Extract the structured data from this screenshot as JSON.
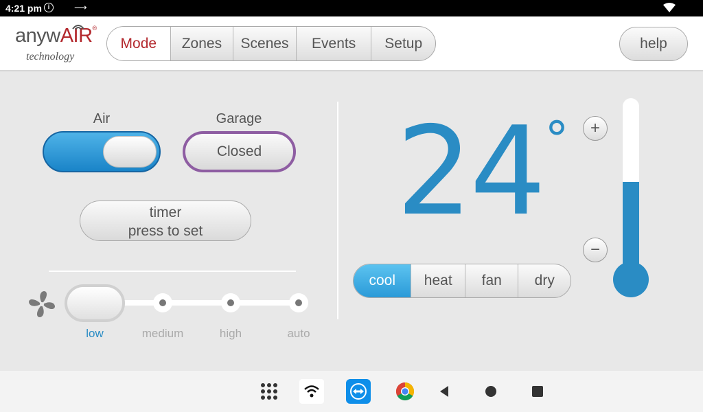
{
  "status_bar": {
    "time": "4:21 pm",
    "info_icon": "info-icon",
    "cast_icon": "cast-icon",
    "wifi_icon": "wifi-icon"
  },
  "logo": {
    "prefix": "anyw",
    "brand": "AIR",
    "reg": "®",
    "sub": "technology"
  },
  "tabs": [
    {
      "label": "Mode",
      "active": true
    },
    {
      "label": "Zones",
      "active": false
    },
    {
      "label": "Scenes",
      "active": false
    },
    {
      "label": "Events",
      "active": false
    },
    {
      "label": "Setup",
      "active": false
    }
  ],
  "help_label": "help",
  "air": {
    "label": "Air",
    "on": true
  },
  "garage": {
    "label": "Garage",
    "state": "Closed"
  },
  "timer": {
    "line1": "timer",
    "line2": "press to set"
  },
  "fan": {
    "speeds": [
      "low",
      "medium",
      "high",
      "auto"
    ],
    "selected": "low"
  },
  "temperature": {
    "value": "24",
    "unit": "°"
  },
  "modes": [
    {
      "label": "cool",
      "active": true
    },
    {
      "label": "heat",
      "active": false
    },
    {
      "label": "fan",
      "active": false
    },
    {
      "label": "dry",
      "active": false
    }
  ],
  "thermometer": {
    "fill_fraction": 0.55
  },
  "colors": {
    "accent": "#2a8cc4",
    "brand": "#b3282d",
    "garage": "#8e5da2"
  },
  "navbar": [
    "apps-icon",
    "wifi-app-icon",
    "teamviewer-icon",
    "chrome-icon",
    "back-icon",
    "home-icon",
    "recents-icon"
  ]
}
